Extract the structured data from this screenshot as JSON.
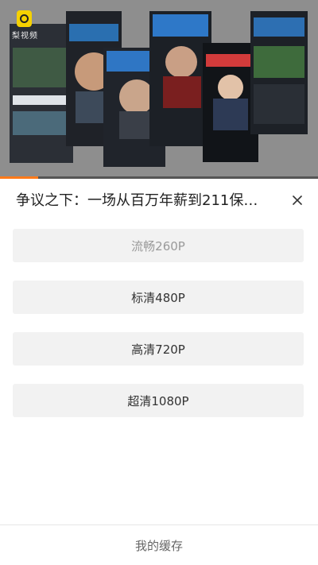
{
  "video": {
    "logo_text": "梨视频",
    "progress_fraction": 0.12,
    "accent_color": "#ff7a1a"
  },
  "sheet": {
    "title": "争议之下：一场从百万年薪到211保…",
    "close_icon": "close-icon"
  },
  "qualities": [
    {
      "label": "流畅260P",
      "state": "disabled"
    },
    {
      "label": "标清480P",
      "state": "normal"
    },
    {
      "label": "高清720P",
      "state": "normal"
    },
    {
      "label": "超清1080P",
      "state": "normal"
    }
  ],
  "footer": {
    "cache_label": "我的缓存"
  }
}
